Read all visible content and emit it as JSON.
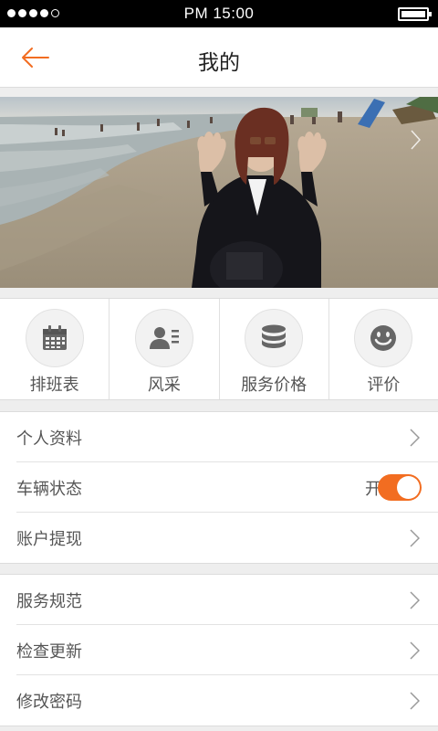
{
  "status_bar": {
    "time": "PM 15:00",
    "signal_dots": 5,
    "signal_filled": 4,
    "battery_level": 1.0
  },
  "header": {
    "title": "我的",
    "back_icon": "arrow-left-icon"
  },
  "colors": {
    "accent": "#f26d21",
    "background": "#eeeeee",
    "divider": "#e2e2e2",
    "text": "#555555"
  },
  "banner": {
    "image": "beach-photo",
    "next_icon": "chevron-right-icon"
  },
  "quick_actions": [
    {
      "label": "排班表",
      "icon": "calendar-icon"
    },
    {
      "label": "风采",
      "icon": "profile-card-icon"
    },
    {
      "label": "服务价格",
      "icon": "database-icon"
    },
    {
      "label": "评价",
      "icon": "smiley-icon"
    }
  ],
  "menu_group_1": [
    {
      "label": "个人资料"
    },
    {
      "label": "车辆状态",
      "toggle_text": "开",
      "toggle_on": true
    },
    {
      "label": "账户提现"
    }
  ],
  "menu_group_2": [
    {
      "label": "服务规范"
    },
    {
      "label": "检查更新"
    },
    {
      "label": "修改密码"
    }
  ]
}
